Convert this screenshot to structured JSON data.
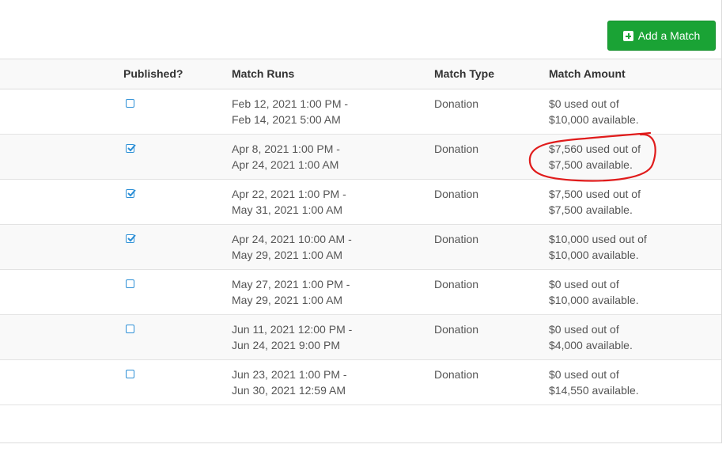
{
  "toolbar": {
    "add_label": "Add a Match"
  },
  "table": {
    "headers": {
      "published": "Published?",
      "runs": "Match Runs",
      "type": "Match Type",
      "amount": "Match Amount"
    },
    "rows": [
      {
        "published": false,
        "runs": [
          "Feb 12, 2021 1:00 PM -",
          "Feb 14, 2021 5:00 AM"
        ],
        "type": "Donation",
        "amount": [
          "$0 used out of",
          "$10,000 available."
        ]
      },
      {
        "published": true,
        "runs": [
          "Apr 8, 2021 1:00 PM -",
          "Apr 24, 2021 1:00 AM"
        ],
        "type": "Donation",
        "amount": [
          "$7,560 used out of",
          "$7,500 available."
        ]
      },
      {
        "published": true,
        "runs": [
          "Apr 22, 2021 1:00 PM -",
          "May 31, 2021 1:00 AM"
        ],
        "type": "Donation",
        "amount": [
          "$7,500 used out of",
          "$7,500 available."
        ]
      },
      {
        "published": true,
        "runs": [
          "Apr 24, 2021 10:00 AM -",
          "May 29, 2021 1:00 AM"
        ],
        "type": "Donation",
        "amount": [
          "$10,000 used out of",
          "$10,000 available."
        ]
      },
      {
        "published": false,
        "runs": [
          "May 27, 2021 1:00 PM -",
          "May 29, 2021 1:00 AM"
        ],
        "type": "Donation",
        "amount": [
          "$0 used out of",
          "$10,000 available."
        ]
      },
      {
        "published": false,
        "runs": [
          "Jun 11, 2021 12:00 PM -",
          "Jun 24, 2021 9:00 PM"
        ],
        "type": "Donation",
        "amount": [
          "$0 used out of",
          "$4,000 available."
        ]
      },
      {
        "published": false,
        "runs": [
          "Jun 23, 2021 1:00 PM -",
          "Jun 30, 2021 12:59 AM"
        ],
        "type": "Donation",
        "amount": [
          "$0 used out of",
          "$14,550 available."
        ]
      }
    ]
  },
  "colors": {
    "accent_green": "#1aa335",
    "checkbox_blue": "#2c8fd6",
    "annotation_red": "#e01b1b"
  }
}
